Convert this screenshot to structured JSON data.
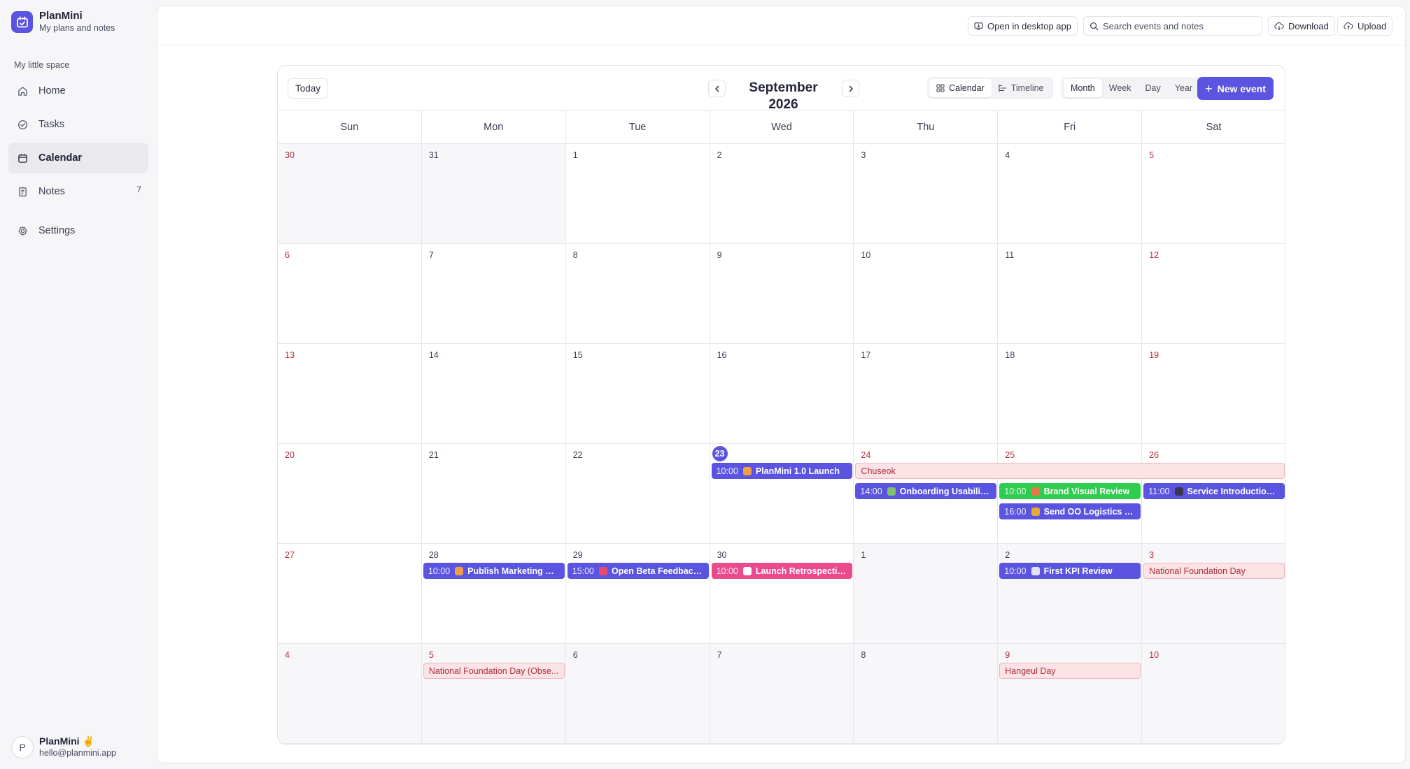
{
  "brand": {
    "name": "PlanMini",
    "subtitle": "My plans and notes"
  },
  "sidebar": {
    "section_label": "My little space",
    "items": [
      {
        "label": "Home",
        "icon": "home-icon"
      },
      {
        "label": "Tasks",
        "icon": "check-circle-icon"
      },
      {
        "label": "Calendar",
        "icon": "calendar-icon",
        "active": true
      },
      {
        "label": "Notes",
        "icon": "note-icon",
        "count": "7"
      },
      {
        "label": "Settings",
        "icon": "gear-icon"
      }
    ],
    "user": {
      "initial": "P",
      "name": "PlanMini ✌️",
      "email": "hello@planmini.app"
    }
  },
  "topbar": {
    "open_desktop": "Open in desktop app",
    "search_placeholder": "Search events and notes",
    "download": "Download",
    "upload": "Upload"
  },
  "calendar": {
    "today_label": "Today",
    "month_title": "September 2026",
    "views": [
      {
        "label": "Calendar",
        "icon": "grid-icon",
        "active": true
      },
      {
        "label": "Timeline",
        "icon": "timeline-icon"
      }
    ],
    "ranges": [
      {
        "label": "Month",
        "active": true
      },
      {
        "label": "Week"
      },
      {
        "label": "Day"
      },
      {
        "label": "Year"
      }
    ],
    "new_event": "New event",
    "weekdays": [
      "Sun",
      "Mon",
      "Tue",
      "Wed",
      "Thu",
      "Fri",
      "Sat"
    ],
    "weeks": [
      [
        {
          "d": "30",
          "out": true,
          "weekend": true
        },
        {
          "d": "31",
          "out": true
        },
        {
          "d": "1"
        },
        {
          "d": "2"
        },
        {
          "d": "3"
        },
        {
          "d": "4"
        },
        {
          "d": "5",
          "weekend": true
        }
      ],
      [
        {
          "d": "6",
          "weekend": true
        },
        {
          "d": "7"
        },
        {
          "d": "8"
        },
        {
          "d": "9"
        },
        {
          "d": "10"
        },
        {
          "d": "11"
        },
        {
          "d": "12",
          "weekend": true
        }
      ],
      [
        {
          "d": "13",
          "weekend": true
        },
        {
          "d": "14"
        },
        {
          "d": "15"
        },
        {
          "d": "16"
        },
        {
          "d": "17"
        },
        {
          "d": "18"
        },
        {
          "d": "19",
          "weekend": true
        }
      ],
      [
        {
          "d": "20",
          "weekend": true
        },
        {
          "d": "21"
        },
        {
          "d": "22"
        },
        {
          "d": "23",
          "today": true
        },
        {
          "d": "24",
          "weekend": true
        },
        {
          "d": "25",
          "weekend": true
        },
        {
          "d": "26",
          "weekend": true
        }
      ],
      [
        {
          "d": "27",
          "weekend": true
        },
        {
          "d": "28"
        },
        {
          "d": "29"
        },
        {
          "d": "30"
        },
        {
          "d": "1",
          "out": true
        },
        {
          "d": "2",
          "out": true
        },
        {
          "d": "3",
          "out": true,
          "weekend": true
        }
      ],
      [
        {
          "d": "4",
          "out": true,
          "weekend": true
        },
        {
          "d": "5",
          "out": true,
          "weekend": true
        },
        {
          "d": "6",
          "out": true
        },
        {
          "d": "7",
          "out": true
        },
        {
          "d": "8",
          "out": true
        },
        {
          "d": "9",
          "out": true,
          "weekend": true
        },
        {
          "d": "10",
          "out": true,
          "weekend": true
        }
      ]
    ],
    "events": [
      {
        "week": 3,
        "day": 3,
        "span": 1,
        "slot": 0,
        "time": "10:00",
        "emoji_color": "#f0a040",
        "title": "PlanMini 1.0 Launch",
        "color": "#5b54e0"
      },
      {
        "week": 3,
        "day": 4,
        "span": 3,
        "slot": 0,
        "title": "Chuseok",
        "kind": "holiday"
      },
      {
        "week": 3,
        "day": 4,
        "span": 1,
        "slot": 1,
        "time": "14:00",
        "emoji_color": "#7cc36b",
        "title": "Onboarding Usability ...",
        "color": "#5b54e0"
      },
      {
        "week": 3,
        "day": 5,
        "span": 1,
        "slot": 1,
        "time": "10:00",
        "emoji_color": "#e8784a",
        "title": "Brand Visual Review",
        "color": "#2fcd4f"
      },
      {
        "week": 3,
        "day": 5,
        "span": 1,
        "slot": 2,
        "time": "16:00",
        "emoji_color": "#e8a935",
        "title": "Send OO Logistics D...",
        "color": "#5b54e0"
      },
      {
        "week": 3,
        "day": 6,
        "span": 1,
        "slot": 1,
        "time": "11:00",
        "emoji_color": "#3a3550",
        "title": "Service Introduction ...",
        "color": "#5b54e0"
      },
      {
        "week": 4,
        "day": 1,
        "span": 1,
        "slot": 0,
        "time": "10:00",
        "emoji_color": "#f0a040",
        "title": "Publish Marketing Co...",
        "color": "#5b54e0"
      },
      {
        "week": 4,
        "day": 2,
        "span": 1,
        "slot": 0,
        "time": "15:00",
        "emoji_color": "#e84a6a",
        "title": "Open Beta Feedback ...",
        "color": "#5b54e0"
      },
      {
        "week": 4,
        "day": 3,
        "span": 1,
        "slot": 0,
        "time": "10:00",
        "emoji_color": "#ffffff",
        "title": "Launch Retrospectiv...",
        "color": "#ec4a8f"
      },
      {
        "week": 4,
        "day": 5,
        "span": 1,
        "slot": 0,
        "time": "10:00",
        "emoji_color": "#dfe3f5",
        "title": "First KPI Review",
        "color": "#5b54e0"
      },
      {
        "week": 4,
        "day": 6,
        "span": 1,
        "slot": 0,
        "title": "National Foundation Day",
        "kind": "holiday"
      },
      {
        "week": 5,
        "day": 1,
        "span": 1,
        "slot": 0,
        "title": "National Foundation Day (Obse...",
        "kind": "holiday"
      },
      {
        "week": 5,
        "day": 5,
        "span": 1,
        "slot": 0,
        "title": "Hangeul Day",
        "kind": "holiday"
      }
    ]
  }
}
